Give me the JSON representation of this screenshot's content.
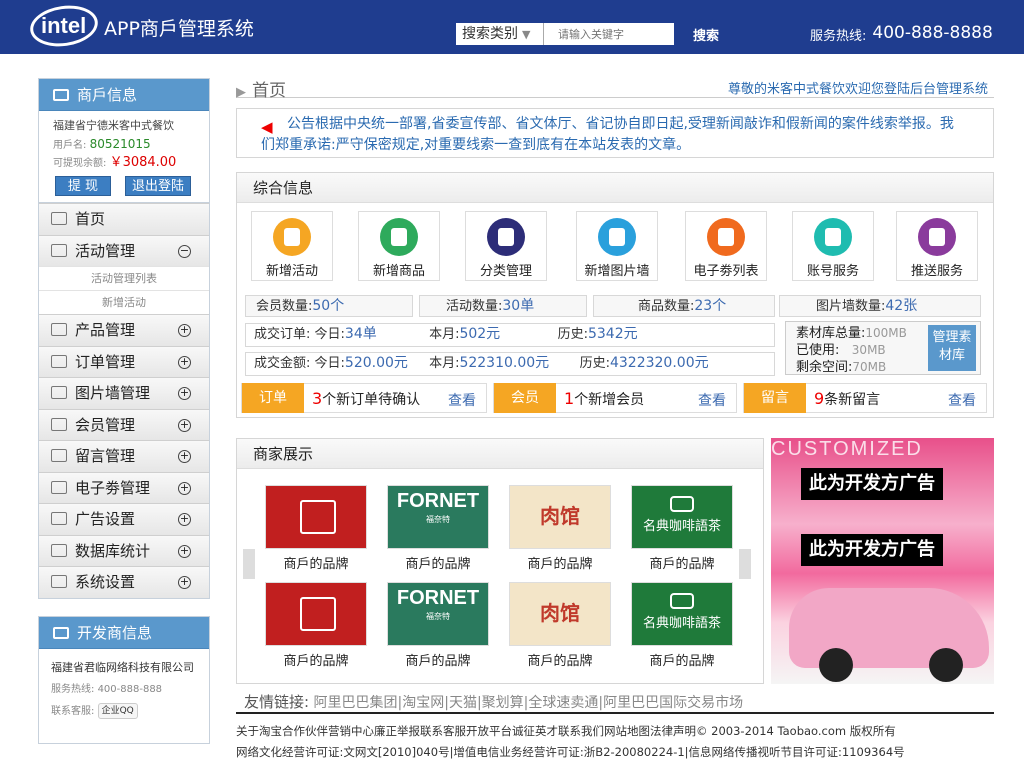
{
  "header": {
    "logo_text": "intel",
    "app_title": "APP商戶管理系统",
    "search_category": "搜索类别",
    "search_placeholder": "请输入关键字",
    "search_button": "搜索",
    "hotline_label": "服务热线:",
    "hotline_number": "400-888-8888"
  },
  "merchant_box": {
    "title": "商戶信息",
    "name": "福建省宁德米客中式餐饮",
    "user_label": "用戶名:",
    "user_id": "80521015",
    "balance_label": "可提现余额:",
    "balance": "￥3084.00",
    "withdraw_btn": "提 现",
    "logout_btn": "退出登陆"
  },
  "menu": {
    "home": "首页",
    "activity": "活动管理",
    "activity_list": "活动管理列表",
    "add_activity": "新增活动",
    "items": [
      "产品管理",
      "订单管理",
      "图片墙管理",
      "会员管理",
      "留言管理",
      "电子劵管理",
      "广告设置",
      "数据库统计",
      "系统设置"
    ]
  },
  "developer_box": {
    "title": "开发商信息",
    "company": "福建省君临网络科技有限公司",
    "hotline_label": "服务热线:",
    "hotline": "400-888-888",
    "service_label": "联系客服:",
    "qq_label": "企业QQ"
  },
  "breadcrumb": {
    "home": "首页",
    "welcome": "尊敬的米客中式餐饮欢迎您登陆后台管理系统"
  },
  "notice": {
    "text": "公告根据中央统一部署,省委宣传部、省文体厅、省记协自即日起,受理新闻敲诈和假新闻的案件线索举报。我们郑重承诺:严守保密规定,对重要线索一查到底有在本站发表的文章。"
  },
  "summary": {
    "title": "综合信息",
    "icons": [
      {
        "label": "新增活动",
        "color": "#f5a623"
      },
      {
        "label": "新增商品",
        "color": "#2eaa5c"
      },
      {
        "label": "分类管理",
        "color": "#2d2d78"
      },
      {
        "label": "新增图片墙",
        "color": "#2aa0dc"
      },
      {
        "label": "电子劵列表",
        "color": "#f06a1e"
      },
      {
        "label": "账号服务",
        "color": "#1fbcb0"
      },
      {
        "label": "推送服务",
        "color": "#8a3b9c"
      }
    ],
    "members_label": "会员数量:",
    "members": "50个",
    "activities_label": "活动数量:",
    "activities": "30单",
    "products_label": "商品数量:",
    "products": "23个",
    "photos_label": "图片墙数量:",
    "photos": "42张",
    "orders_label": "成交订单:",
    "today_label": "今日:",
    "month_label": "本月:",
    "history_label": "历史:",
    "orders_today": "34单",
    "orders_month": "502元",
    "orders_history": "5342元",
    "amount_label": "成交金额:",
    "amount_today": "520.00元",
    "amount_month": "522310.00元",
    "amount_history": "4322320.00元",
    "mat_total_label": "素材库总量:",
    "mat_total": "100MB",
    "mat_used_label": "已使用:",
    "mat_used": "30MB",
    "mat_left_label": "剩余空间:",
    "mat_left": "70MB",
    "mat_btn": "管理素材库",
    "alerts": [
      {
        "tag": "订单",
        "count": "3",
        "text": "个新订单待确认",
        "link": "查看"
      },
      {
        "tag": "会员",
        "count": "1",
        "text": "个新增会员",
        "link": "查看"
      },
      {
        "tag": "留言",
        "count": "9",
        "text": "条新留言",
        "link": "查看"
      }
    ]
  },
  "showcase": {
    "title": "商家展示",
    "brand_label": "商戶的品牌",
    "b2_text": "FORNET",
    "b2_sub": "福奈特",
    "b3_text": "肉馆",
    "b4_text": "名典咖啡語茶"
  },
  "ad": {
    "top_text": "CUSTOMIZED",
    "label1": "此为开发方广告",
    "label2": "此为开发方广告"
  },
  "links": {
    "label": "友情链接:",
    "items": "阿里巴巴集团|淘宝网|天猫|聚划算|全球速卖通|阿里巴巴国际交易市场"
  },
  "footer": {
    "line1": "关于淘宝合作伙伴营销中心廉正举报联系客服开放平台诚征英才联系我们网站地图法律声明© 2003-2014 Taobao.com 版权所有",
    "line2": "网络文化经营许可证:文网文[2010]040号|增值电信业务经营许可证:浙B2-20080224-1|信息网络传播视听节目许可证:1109364号"
  }
}
